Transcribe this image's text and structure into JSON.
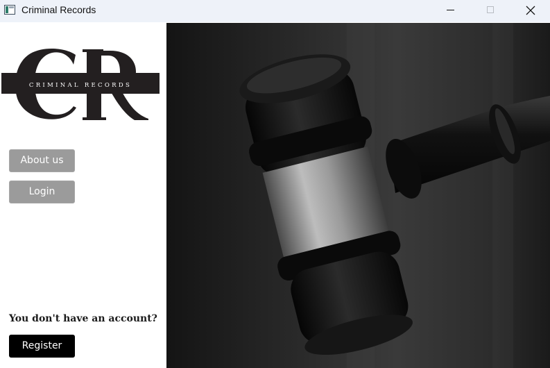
{
  "window": {
    "title": "Criminal Records",
    "icons": {
      "app": "app-window-icon",
      "minimize": "minimize-icon",
      "maximize": "maximize-icon",
      "close": "close-icon"
    }
  },
  "logo": {
    "monogram": "CR",
    "tagline": "CRIMINAL RECORDS"
  },
  "nav": {
    "about_label": "About us",
    "login_label": "Login"
  },
  "account": {
    "prompt": "You don't have an account?",
    "register_label": "Register"
  },
  "hero": {
    "image": "judge-gavel-photo"
  },
  "colors": {
    "titlebar": "#eef2f9",
    "nav_button": "#9b9b9b",
    "register_button": "#000000",
    "logo_ink": "#231f20"
  }
}
